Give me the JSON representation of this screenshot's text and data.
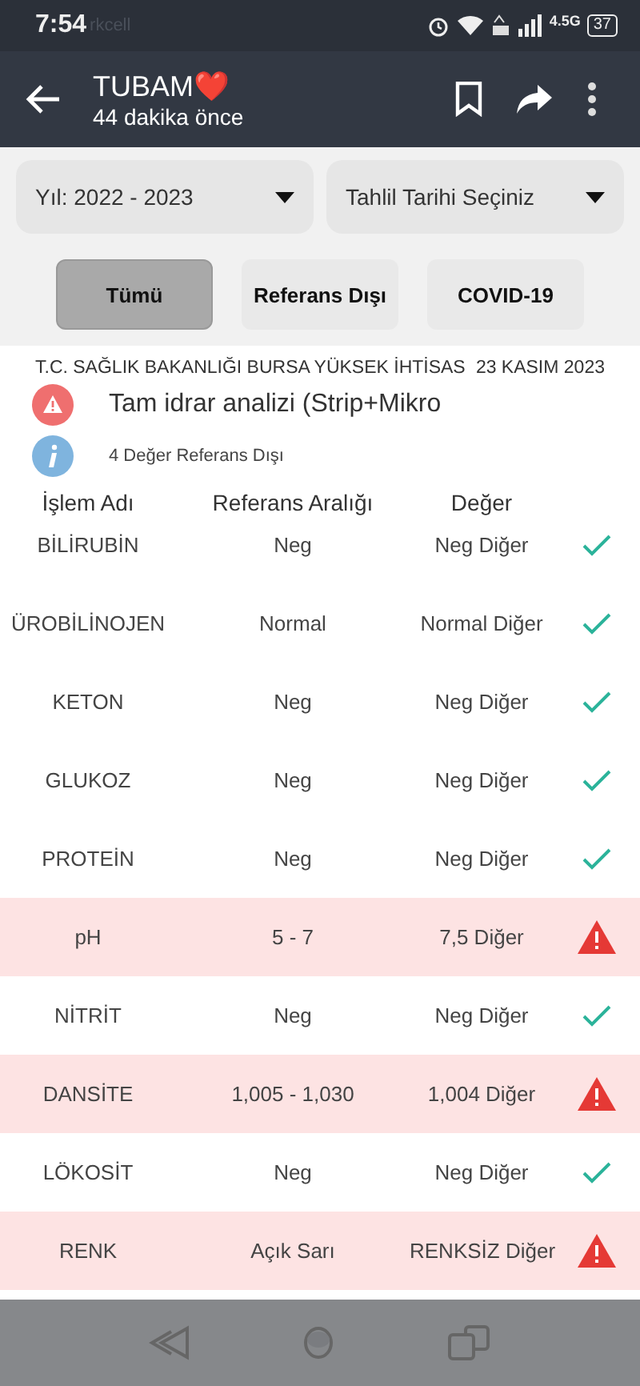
{
  "status_bar": {
    "time": "7:54",
    "carrier": "rkcell",
    "battery": "37",
    "network": "4.5G"
  },
  "chat_header": {
    "name": "TUBAM❤️",
    "subtitle": "44 dakika önce"
  },
  "filters": [
    {
      "label": "Yıl: 2022 - 2023"
    },
    {
      "label": "Tahlil Tarihi Seçiniz"
    }
  ],
  "tabs": [
    {
      "label": "Tümü",
      "selected": true
    },
    {
      "label": "Referans Dışı",
      "selected": false
    },
    {
      "label": "COVID-19",
      "selected": false
    }
  ],
  "report": {
    "institution": "T.C. SAĞLIK BAKANLIĞI BURSA YÜKSEK İHTİSAS",
    "date": "23 KASIM 2023",
    "test_name": "Tam idrar analizi (Strip+Mikro",
    "summary": "4 Değer Referans Dışı"
  },
  "table": {
    "columns": [
      "İşlem Adı",
      "Referans Aralığı",
      "Değer"
    ],
    "rows": [
      {
        "name": "BİLİRUBİN",
        "reference": "Neg",
        "value": "Neg Diğer",
        "kind": "normal"
      },
      {
        "name": "ÜROBİLİNOJEN",
        "reference": "Normal",
        "value": "Normal Diğer",
        "kind": "normal"
      },
      {
        "name": "KETON",
        "reference": "Neg",
        "value": "Neg Diğer",
        "kind": "normal"
      },
      {
        "name": "GLUKOZ",
        "reference": "Neg",
        "value": "Neg Diğer",
        "kind": "normal"
      },
      {
        "name": "PROTEİN",
        "reference": "Neg",
        "value": "Neg Diğer",
        "kind": "normal"
      },
      {
        "name": "pH",
        "reference": "5 - 7",
        "value": "7,5 Diğer",
        "kind": "abnormal"
      },
      {
        "name": "NİTRİT",
        "reference": "Neg",
        "value": "Neg Diğer",
        "kind": "normal"
      },
      {
        "name": "DANSİTE",
        "reference": "1,005 - 1,030",
        "value": "1,004 Diğer",
        "kind": "abnormal"
      },
      {
        "name": "LÖKOSİT",
        "reference": "Neg",
        "value": "Neg Diğer",
        "kind": "normal"
      },
      {
        "name": "RENK",
        "reference": "Açık Sarı",
        "value": "RENKSİZ Diğer",
        "kind": "abnormal"
      }
    ]
  }
}
